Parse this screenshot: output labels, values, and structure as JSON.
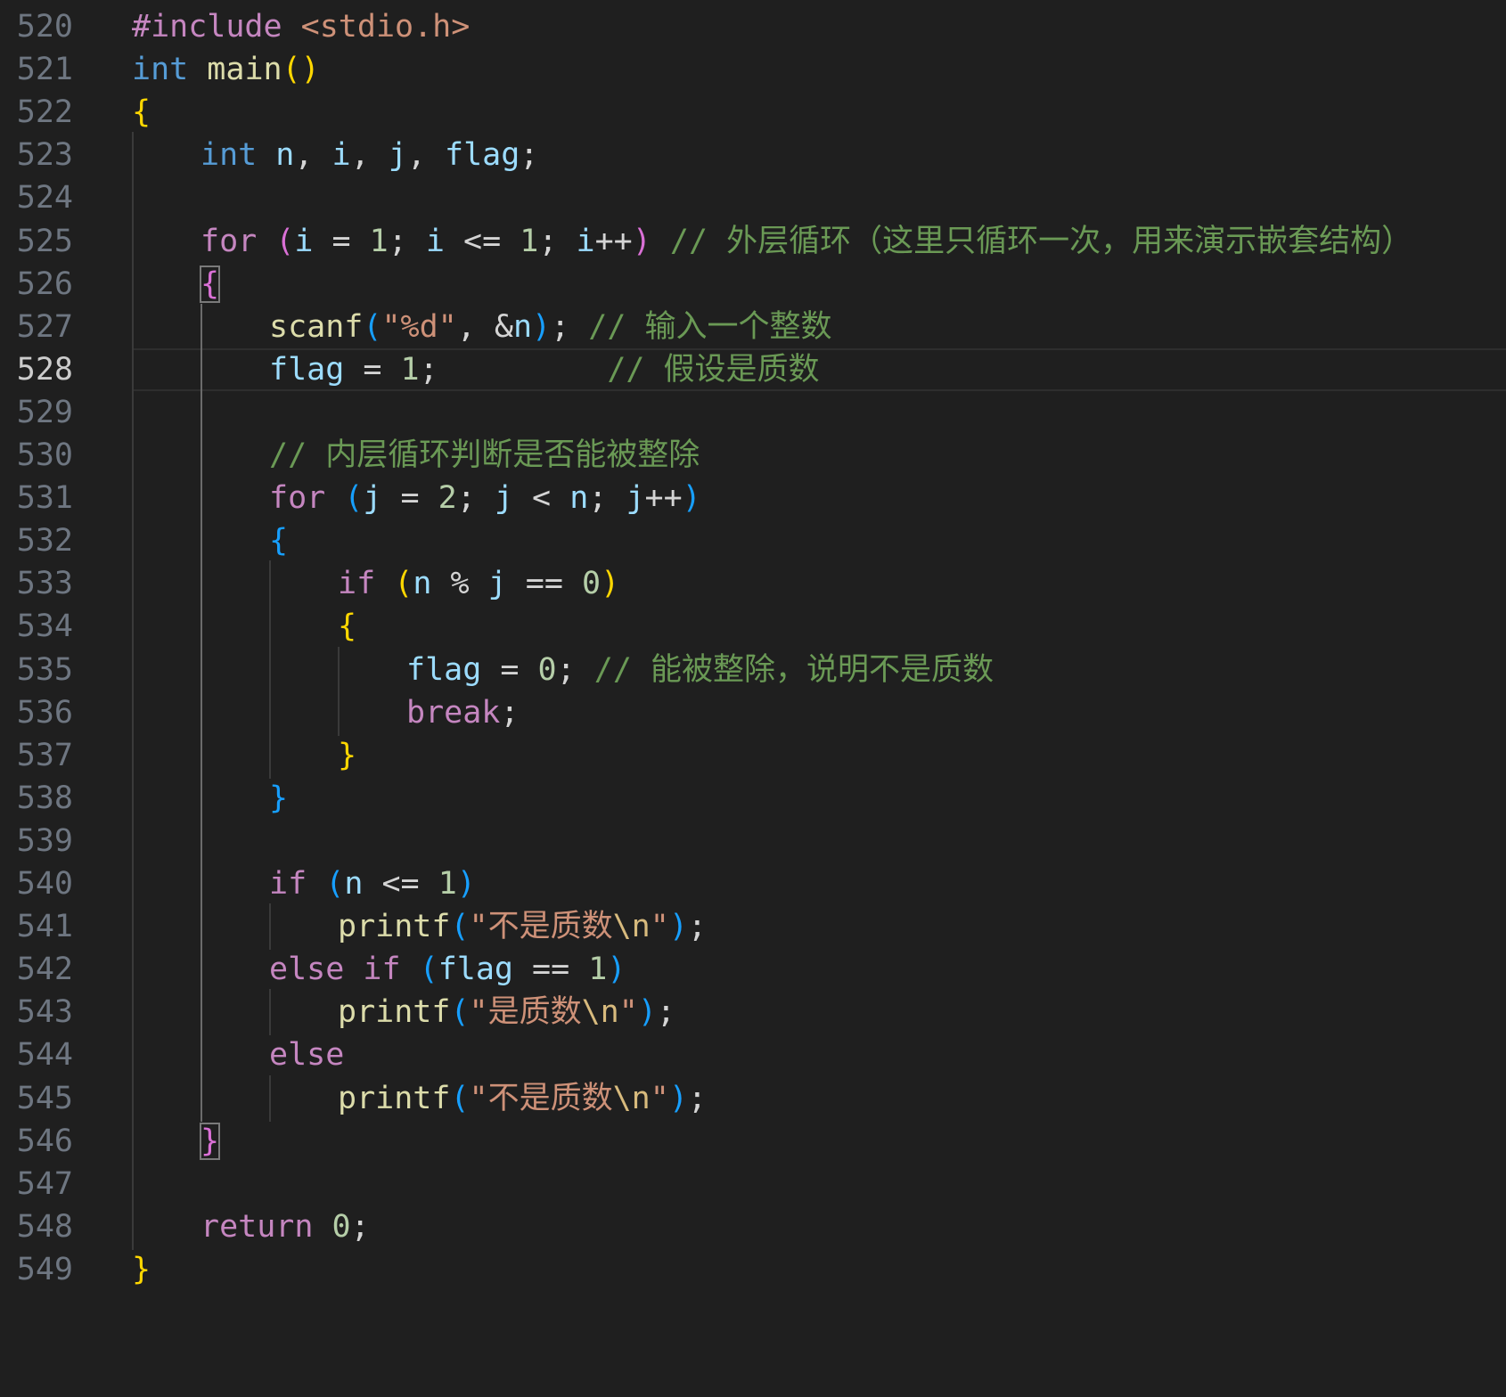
{
  "editor": {
    "language": "c",
    "current_line": 528,
    "colors": {
      "background": "#1f1f1f",
      "line_number": "#6e7681",
      "line_number_active": "#cccccc",
      "keyword": "#569cd6",
      "control": "#c586c0",
      "function": "#dcdcaa",
      "variable": "#9cdcfe",
      "number": "#b5cea8",
      "string": "#ce9178",
      "comment": "#6a9955",
      "bracket_level1": "#ffd700",
      "bracket_level2": "#da70d6",
      "bracket_level3": "#179fff"
    },
    "lines": [
      {
        "n": "520",
        "indent": 0,
        "tokens": [
          [
            "t-ctl",
            "#include "
          ],
          [
            "t-str",
            "<stdio.h>"
          ]
        ]
      },
      {
        "n": "521",
        "indent": 0,
        "tokens": [
          [
            "t-kw",
            "int"
          ],
          [
            "t-p",
            " "
          ],
          [
            "t-fn",
            "main"
          ],
          [
            "t-b1",
            "()"
          ]
        ]
      },
      {
        "n": "522",
        "indent": 0,
        "tokens": [
          [
            "t-b1",
            "{"
          ]
        ]
      },
      {
        "n": "523",
        "indent": 1,
        "tokens": [
          [
            "t-kw",
            "int"
          ],
          [
            "t-p",
            " "
          ],
          [
            "t-var",
            "n"
          ],
          [
            "t-p",
            ", "
          ],
          [
            "t-var",
            "i"
          ],
          [
            "t-p",
            ", "
          ],
          [
            "t-var",
            "j"
          ],
          [
            "t-p",
            ", "
          ],
          [
            "t-var",
            "flag"
          ],
          [
            "t-p",
            ";"
          ]
        ]
      },
      {
        "n": "524",
        "indent": 1,
        "tokens": []
      },
      {
        "n": "525",
        "indent": 1,
        "tokens": [
          [
            "t-ctl",
            "for"
          ],
          [
            "t-p",
            " "
          ],
          [
            "t-b2",
            "("
          ],
          [
            "t-var",
            "i"
          ],
          [
            "t-op",
            " = "
          ],
          [
            "t-num",
            "1"
          ],
          [
            "t-p",
            "; "
          ],
          [
            "t-var",
            "i"
          ],
          [
            "t-op",
            " <= "
          ],
          [
            "t-num",
            "1"
          ],
          [
            "t-p",
            "; "
          ],
          [
            "t-var",
            "i"
          ],
          [
            "t-op",
            "++"
          ],
          [
            "t-b2",
            ")"
          ],
          [
            "t-p",
            " "
          ],
          [
            "t-cmt",
            "// 外层循环（这里只循环一次，用来演示嵌套结构）"
          ]
        ]
      },
      {
        "n": "526",
        "indent": 1,
        "tokens": [
          [
            "t-b2 bm",
            "{"
          ]
        ]
      },
      {
        "n": "527",
        "indent": 2,
        "tokens": [
          [
            "t-fn",
            "scanf"
          ],
          [
            "t-b3",
            "("
          ],
          [
            "t-str",
            "\"%d\""
          ],
          [
            "t-p",
            ", "
          ],
          [
            "t-op",
            "&"
          ],
          [
            "t-var",
            "n"
          ],
          [
            "t-b3",
            ")"
          ],
          [
            "t-p",
            "; "
          ],
          [
            "t-cmt",
            "// 输入一个整数"
          ]
        ]
      },
      {
        "n": "528",
        "indent": 2,
        "tokens": [
          [
            "t-var",
            "flag"
          ],
          [
            "t-op",
            " = "
          ],
          [
            "t-num",
            "1"
          ],
          [
            "t-p",
            ";         "
          ],
          [
            "t-cmt",
            "// 假设是质数"
          ]
        ]
      },
      {
        "n": "529",
        "indent": 2,
        "tokens": []
      },
      {
        "n": "530",
        "indent": 2,
        "tokens": [
          [
            "t-cmt",
            "// 内层循环判断是否能被整除"
          ]
        ]
      },
      {
        "n": "531",
        "indent": 2,
        "tokens": [
          [
            "t-ctl",
            "for"
          ],
          [
            "t-p",
            " "
          ],
          [
            "t-b3",
            "("
          ],
          [
            "t-var",
            "j"
          ],
          [
            "t-op",
            " = "
          ],
          [
            "t-num",
            "2"
          ],
          [
            "t-p",
            "; "
          ],
          [
            "t-var",
            "j"
          ],
          [
            "t-op",
            " < "
          ],
          [
            "t-var",
            "n"
          ],
          [
            "t-p",
            "; "
          ],
          [
            "t-var",
            "j"
          ],
          [
            "t-op",
            "++"
          ],
          [
            "t-b3",
            ")"
          ]
        ]
      },
      {
        "n": "532",
        "indent": 2,
        "tokens": [
          [
            "t-b3",
            "{"
          ]
        ]
      },
      {
        "n": "533",
        "indent": 3,
        "tokens": [
          [
            "t-ctl",
            "if"
          ],
          [
            "t-p",
            " "
          ],
          [
            "t-b1",
            "("
          ],
          [
            "t-var",
            "n"
          ],
          [
            "t-op",
            " % "
          ],
          [
            "t-var",
            "j"
          ],
          [
            "t-op",
            " == "
          ],
          [
            "t-num",
            "0"
          ],
          [
            "t-b1",
            ")"
          ]
        ]
      },
      {
        "n": "534",
        "indent": 3,
        "tokens": [
          [
            "t-b1",
            "{"
          ]
        ]
      },
      {
        "n": "535",
        "indent": 4,
        "tokens": [
          [
            "t-var",
            "flag"
          ],
          [
            "t-op",
            " = "
          ],
          [
            "t-num",
            "0"
          ],
          [
            "t-p",
            "; "
          ],
          [
            "t-cmt",
            "// 能被整除，说明不是质数"
          ]
        ]
      },
      {
        "n": "536",
        "indent": 4,
        "tokens": [
          [
            "t-ctl",
            "break"
          ],
          [
            "t-p",
            ";"
          ]
        ]
      },
      {
        "n": "537",
        "indent": 3,
        "tokens": [
          [
            "t-b1",
            "}"
          ]
        ]
      },
      {
        "n": "538",
        "indent": 2,
        "tokens": [
          [
            "t-b3",
            "}"
          ]
        ]
      },
      {
        "n": "539",
        "indent": 2,
        "tokens": []
      },
      {
        "n": "540",
        "indent": 2,
        "tokens": [
          [
            "t-ctl",
            "if"
          ],
          [
            "t-p",
            " "
          ],
          [
            "t-b3",
            "("
          ],
          [
            "t-var",
            "n"
          ],
          [
            "t-op",
            " <= "
          ],
          [
            "t-num",
            "1"
          ],
          [
            "t-b3",
            ")"
          ]
        ]
      },
      {
        "n": "541",
        "indent": 3,
        "tokens": [
          [
            "t-fn",
            "printf"
          ],
          [
            "t-b3",
            "("
          ],
          [
            "t-str",
            "\"不是质数"
          ],
          [
            "t-esc",
            "\\n"
          ],
          [
            "t-str",
            "\""
          ],
          [
            "t-b3",
            ")"
          ],
          [
            "t-p",
            ";"
          ]
        ]
      },
      {
        "n": "542",
        "indent": 2,
        "tokens": [
          [
            "t-ctl",
            "else"
          ],
          [
            "t-p",
            " "
          ],
          [
            "t-ctl",
            "if"
          ],
          [
            "t-p",
            " "
          ],
          [
            "t-b3",
            "("
          ],
          [
            "t-var",
            "flag"
          ],
          [
            "t-op",
            " == "
          ],
          [
            "t-num",
            "1"
          ],
          [
            "t-b3",
            ")"
          ]
        ]
      },
      {
        "n": "543",
        "indent": 3,
        "tokens": [
          [
            "t-fn",
            "printf"
          ],
          [
            "t-b3",
            "("
          ],
          [
            "t-str",
            "\"是质数"
          ],
          [
            "t-esc",
            "\\n"
          ],
          [
            "t-str",
            "\""
          ],
          [
            "t-b3",
            ")"
          ],
          [
            "t-p",
            ";"
          ]
        ]
      },
      {
        "n": "544",
        "indent": 2,
        "tokens": [
          [
            "t-ctl",
            "else"
          ]
        ]
      },
      {
        "n": "545",
        "indent": 3,
        "tokens": [
          [
            "t-fn",
            "printf"
          ],
          [
            "t-b3",
            "("
          ],
          [
            "t-str",
            "\"不是质数"
          ],
          [
            "t-esc",
            "\\n"
          ],
          [
            "t-str",
            "\""
          ],
          [
            "t-b3",
            ")"
          ],
          [
            "t-p",
            ";"
          ]
        ]
      },
      {
        "n": "546",
        "indent": 1,
        "tokens": [
          [
            "t-b2 bm",
            "}"
          ]
        ]
      },
      {
        "n": "547",
        "indent": 1,
        "tokens": []
      },
      {
        "n": "548",
        "indent": 1,
        "tokens": [
          [
            "t-ctl",
            "return"
          ],
          [
            "t-p",
            " "
          ],
          [
            "t-num",
            "0"
          ],
          [
            "t-p",
            ";"
          ]
        ]
      },
      {
        "n": "549",
        "indent": 0,
        "tokens": [
          [
            "t-b1",
            "}"
          ]
        ]
      }
    ]
  }
}
